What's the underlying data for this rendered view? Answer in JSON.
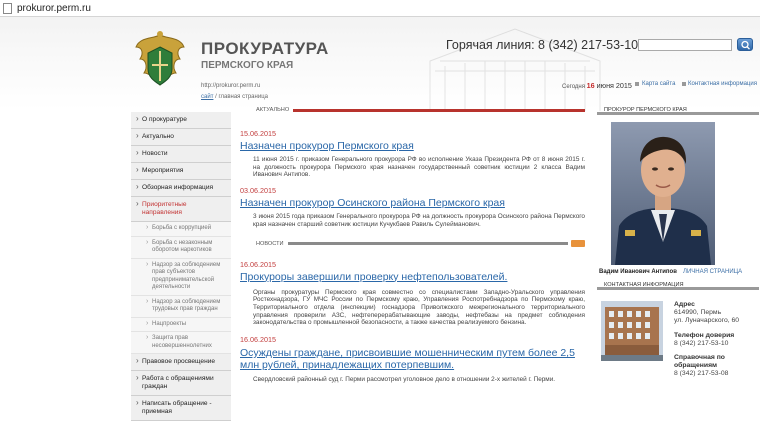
{
  "browser": {
    "url": "prokuror.perm.ru"
  },
  "header": {
    "title": "ПРОКУРАТУРА",
    "subtitle": "ПЕРМСКОГО КРАЯ",
    "site_url": "http://prokuror.perm.ru",
    "breadcrumb_home": "сайт",
    "breadcrumb_current": "главная страница",
    "hotline": "Горячая линия: 8 (342) 217-53-10",
    "search_placeholder": "",
    "today_label": "Сегодня",
    "today_day": "16",
    "today_rest": "июня 2015",
    "map_link": "Карта сайта",
    "contacts_link": "Контактная информация"
  },
  "sidebar": {
    "items": [
      {
        "label": "О прокуратуре"
      },
      {
        "label": "Актуально"
      },
      {
        "label": "Новости"
      },
      {
        "label": "Мероприятия"
      },
      {
        "label": "Обзорная информация"
      },
      {
        "label": "Приоритетные направления"
      }
    ],
    "subitems": [
      {
        "label": "Борьба с коррупцией"
      },
      {
        "label": "Борьба с незаконным оборотом наркотиков"
      },
      {
        "label": "Надзор за соблюдением прав субъектов предпринимательской деятельности"
      },
      {
        "label": "Надзор за соблюдением трудовых прав граждан"
      },
      {
        "label": "Нацпроекты"
      },
      {
        "label": "Защита прав несовершеннолетних"
      }
    ],
    "bottom": [
      {
        "label": "Правовое просвещение"
      },
      {
        "label": "Работа с обращениями граждан"
      },
      {
        "label": "Написать обращение - приемная"
      }
    ]
  },
  "actual": {
    "label": "АКТУАЛЬНО",
    "items": [
      {
        "date": "15.06.2015",
        "title": "Назначен прокурор Пермского края",
        "text": "11 июня 2015 г. приказом Генерального прокурора РФ во исполнение Указа Президента РФ от 8 июня 2015 г. на должность прокурора Пермского края назначен государственный советник юстиции 2 класса Вадим Иванович Антипов."
      },
      {
        "date": "03.06.2015",
        "title": "Назначен прокурор Осинского района Пермского края",
        "text": "3 июня 2015 года приказом Генерального прокурора РФ на должность прокурора Осинского района Пермского края назначен старший советник юстиции Кучукбаев Равиль Сулейманович."
      }
    ]
  },
  "news": {
    "label": "НОВОСТИ",
    "items": [
      {
        "date": "16.06.2015",
        "title": "Прокуроры завершили проверку нефтепользователей.",
        "text": "Органы прокуратуры Пермского края совместно со специалистами Западно-Уральского управления Ростехнадзора, ГУ МЧС России по Пермскому краю, Управления Роспотребнадзора по Пермскому краю, Территориального отдела (инспекции) госнадзора Приволжского межрегионального территориального управления проверили АЗС, нефтеперерабатывающие заводы, нефтебазы на предмет соблюдения законодательства о промышленной безопасности, а также качества реализуемого бензина."
      },
      {
        "date": "16.06.2015",
        "title": "Осуждены граждане, присвоившие мошенническим путем более 2,5 млн рублей, принадлежащих потерпевшим.",
        "text": "Свердловский районный суд г. Перми рассмотрел уголовное дело в отношении 2-х жителей г. Перми."
      }
    ]
  },
  "right": {
    "prosecutor_label": "ПРОКУРОР ПЕРМСКОГО КРАЯ",
    "name": "Вадим Иванович Антипов",
    "personal_link": "ЛИЧНАЯ СТРАНИЦА",
    "contacts_label": "КОНТАКТНАЯ ИНФОРМАЦИЯ",
    "address_label": "Адрес",
    "address_line1": "614990, Пермь",
    "address_line2": "ул. Луначарского, 60",
    "phone_label": "Телефон доверия",
    "phone": "8 (342) 217-53-10",
    "help_label": "Справочная по обращениям",
    "help_phone": "8 (342) 217-53-08"
  },
  "colors": {
    "accent_red": "#c23333",
    "link_blue": "#2a67a8",
    "actual_bar": "#b8332d",
    "news_bar": "#8a8a8a"
  }
}
